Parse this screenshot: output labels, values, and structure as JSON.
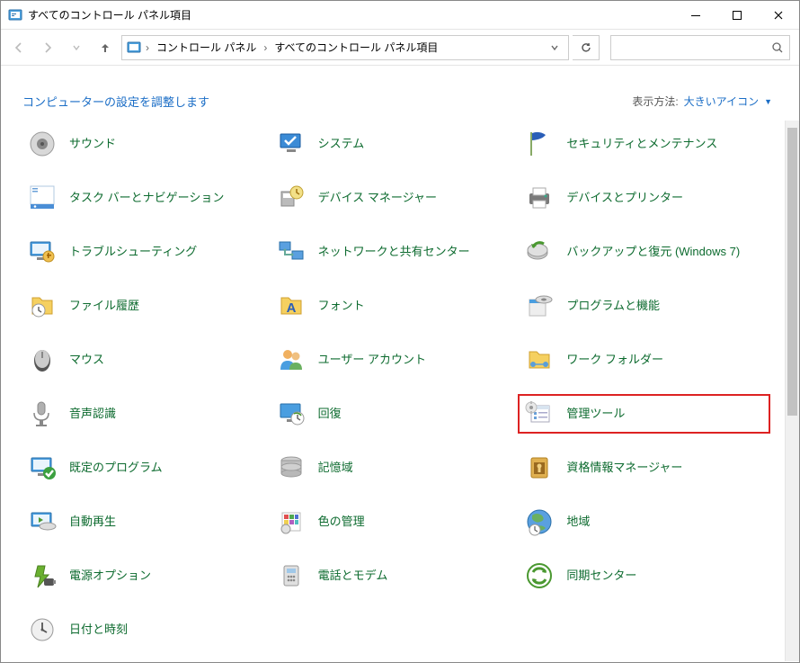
{
  "window": {
    "title": "すべてのコントロール パネル項目"
  },
  "breadcrumb": {
    "items": [
      "コントロール パネル",
      "すべてのコントロール パネル項目"
    ]
  },
  "header": {
    "heading": "コンピューターの設定を調整します",
    "view_label": "表示方法:",
    "view_value": "大きいアイコン"
  },
  "items": [
    {
      "label": "サウンド",
      "icon": "speaker"
    },
    {
      "label": "システム",
      "icon": "monitor-check"
    },
    {
      "label": "セキュリティとメンテナンス",
      "icon": "flag"
    },
    {
      "label": "タスク バーとナビゲーション",
      "icon": "taskbar"
    },
    {
      "label": "デバイス マネージャー",
      "icon": "device"
    },
    {
      "label": "デバイスとプリンター",
      "icon": "printer"
    },
    {
      "label": "トラブルシューティング",
      "icon": "troubleshoot"
    },
    {
      "label": "ネットワークと共有センター",
      "icon": "network"
    },
    {
      "label": "バックアップと復元 (Windows 7)",
      "icon": "backup"
    },
    {
      "label": "ファイル履歴",
      "icon": "filehistory"
    },
    {
      "label": "フォント",
      "icon": "fonts"
    },
    {
      "label": "プログラムと機能",
      "icon": "programs"
    },
    {
      "label": "マウス",
      "icon": "mouse"
    },
    {
      "label": "ユーザー アカウント",
      "icon": "users"
    },
    {
      "label": "ワーク フォルダー",
      "icon": "workfolder"
    },
    {
      "label": "音声認識",
      "icon": "mic"
    },
    {
      "label": "回復",
      "icon": "recovery"
    },
    {
      "label": "管理ツール",
      "icon": "admintools",
      "highlight": true
    },
    {
      "label": "既定のプログラム",
      "icon": "defaultprog"
    },
    {
      "label": "記憶域",
      "icon": "storage"
    },
    {
      "label": "資格情報マネージャー",
      "icon": "credential"
    },
    {
      "label": "自動再生",
      "icon": "autoplay"
    },
    {
      "label": "色の管理",
      "icon": "color"
    },
    {
      "label": "地域",
      "icon": "region"
    },
    {
      "label": "電源オプション",
      "icon": "power"
    },
    {
      "label": "電話とモデム",
      "icon": "phone"
    },
    {
      "label": "同期センター",
      "icon": "sync"
    },
    {
      "label": "日付と時刻",
      "icon": "datetime"
    }
  ],
  "colors": {
    "link_green": "#0d6b2f",
    "heading_blue": "#1a6dc6",
    "highlight_red": "#d22"
  }
}
